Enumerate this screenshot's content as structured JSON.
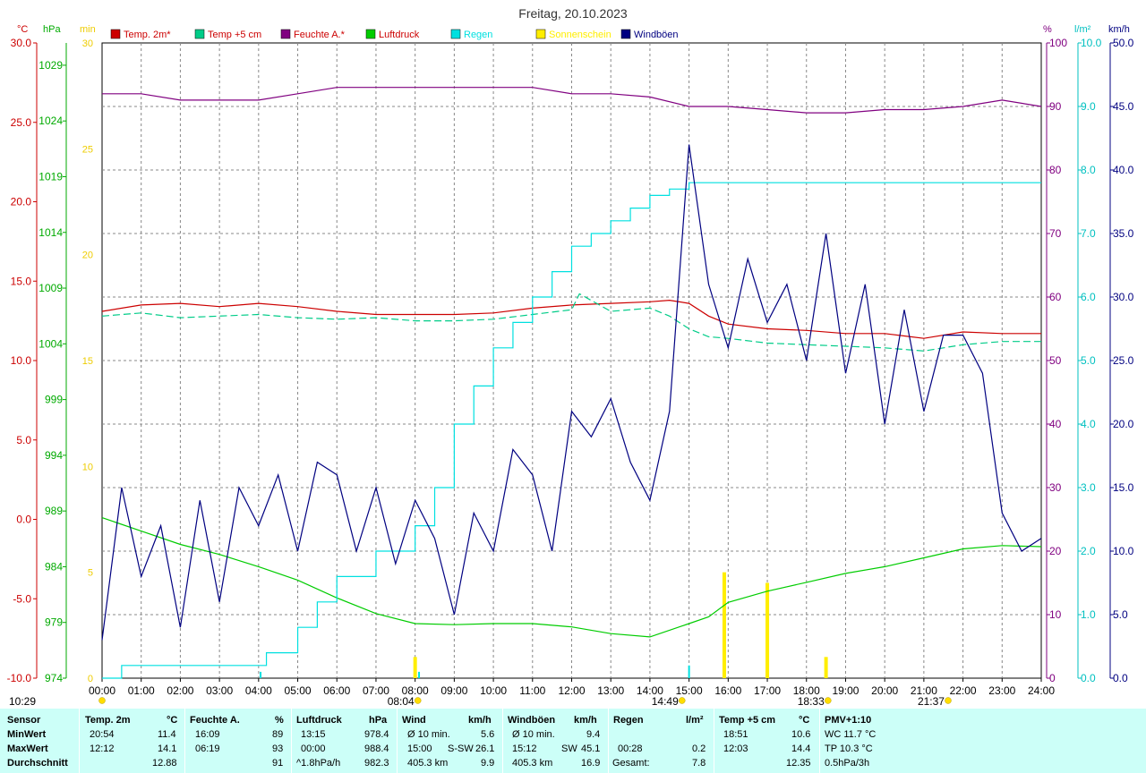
{
  "chart_data": {
    "type": "line",
    "title": "Freitag, 20.10.2023",
    "legend": [
      "Temp. 2m*",
      "Temp +5 cm",
      "Feuchte A.*",
      "Luftdruck",
      "Regen",
      "Sonnenschein",
      "Windböen"
    ],
    "colors": {
      "temp2m": "#cc0000",
      "temp5cm": "#00cc88",
      "feuchte": "#800080",
      "luftdruck": "#00cc00",
      "regen": "#00e0e0",
      "sonne": "#ffee00",
      "windboeen": "#000080",
      "grid": "#888888",
      "axis": "#000000"
    },
    "axis_units_left": [
      "°C",
      "hPa",
      "min"
    ],
    "axis_units_right": [
      "%",
      "l/m²",
      "km/h"
    ],
    "x_ticks": [
      "00:00",
      "01:00",
      "02:00",
      "03:00",
      "04:00",
      "05:00",
      "06:00",
      "07:00",
      "08:00",
      "09:00",
      "10:00",
      "11:00",
      "12:00",
      "13:00",
      "14:00",
      "15:00",
      "16:00",
      "17:00",
      "18:00",
      "19:00",
      "20:00",
      "21:00",
      "22:00",
      "23:00",
      "24:00"
    ],
    "temp_axis": {
      "range": [
        -10,
        30
      ],
      "ticks": [
        "30.0",
        "25.0",
        "20.0",
        "15.0",
        "10.0",
        "5.0",
        "0.0",
        "-5.0",
        "-10.0"
      ]
    },
    "pressure_axis": {
      "range": [
        974,
        1031
      ],
      "ticks": [
        "1029",
        "1024",
        "1019",
        "1014",
        "1009",
        "1004",
        "999",
        "994",
        "989",
        "984",
        "979",
        "974"
      ]
    },
    "sun_axis": {
      "range": [
        0,
        30
      ],
      "ticks": [
        "30",
        "25",
        "20",
        "15",
        "10",
        "5",
        "0"
      ]
    },
    "humidity_axis": {
      "range": [
        0,
        100
      ],
      "ticks": [
        "100",
        "90",
        "80",
        "70",
        "60",
        "50",
        "40",
        "30",
        "20",
        "10",
        "0"
      ]
    },
    "rain_axis": {
      "range": [
        0,
        10
      ],
      "ticks": [
        "10.0",
        "9.0",
        "8.0",
        "7.0",
        "6.0",
        "5.0",
        "4.0",
        "3.0",
        "2.0",
        "1.0",
        "0.0"
      ]
    },
    "wind_axis": {
      "range": [
        0,
        50
      ],
      "ticks": [
        "50.0",
        "45.0",
        "40.0",
        "35.0",
        "30.0",
        "25.0",
        "20.0",
        "15.0",
        "10.0",
        "5.0",
        "0.0"
      ]
    },
    "series": [
      {
        "name": "Temp. 2m*",
        "x": [
          0,
          1,
          2,
          3,
          4,
          5,
          6,
          7,
          8,
          9,
          10,
          11,
          12,
          13,
          14,
          14.5,
          15,
          15.5,
          16,
          17,
          18,
          19,
          20,
          21,
          22,
          23,
          24
        ],
        "values": [
          13.1,
          13.5,
          13.6,
          13.4,
          13.6,
          13.4,
          13.1,
          12.9,
          12.9,
          12.9,
          13.0,
          13.3,
          13.5,
          13.6,
          13.7,
          13.8,
          13.6,
          12.8,
          12.3,
          12.0,
          11.9,
          11.7,
          11.7,
          11.4,
          11.8,
          11.7,
          11.7
        ]
      },
      {
        "name": "Temp +5 cm",
        "x": [
          0,
          1,
          2,
          3,
          4,
          5,
          6,
          7,
          8,
          9,
          10,
          11,
          12,
          12.2,
          13,
          14,
          14.5,
          15,
          15.5,
          16,
          17,
          18,
          19,
          20,
          21,
          22,
          23,
          24
        ],
        "values": [
          12.8,
          13.0,
          12.7,
          12.8,
          12.9,
          12.7,
          12.6,
          12.7,
          12.5,
          12.5,
          12.6,
          12.9,
          13.2,
          14.2,
          13.1,
          13.3,
          12.8,
          12.0,
          11.5,
          11.4,
          11.1,
          11.0,
          10.9,
          10.8,
          10.6,
          11.0,
          11.2,
          11.2
        ]
      },
      {
        "name": "Feuchte A.*",
        "x": [
          0,
          1,
          2,
          3,
          4,
          5,
          6,
          7,
          8,
          9,
          10,
          11,
          12,
          13,
          14,
          15,
          15.5,
          16,
          17,
          18,
          19,
          20,
          21,
          22,
          23,
          24
        ],
        "values": [
          92,
          92,
          91,
          91,
          91,
          92,
          93,
          93,
          93,
          93,
          93,
          93,
          92,
          92,
          91.5,
          90,
          90,
          90,
          89.5,
          89,
          89,
          89.5,
          89.5,
          90,
          91,
          90
        ]
      },
      {
        "name": "Luftdruck",
        "x": [
          0,
          1,
          2,
          3,
          4,
          5,
          6,
          7,
          8,
          9,
          10,
          11,
          12,
          13,
          14,
          15,
          15.5,
          16,
          17,
          18,
          19,
          20,
          21,
          22,
          23,
          24
        ],
        "values": [
          988.4,
          987.2,
          986.0,
          985.1,
          984.0,
          982.8,
          981.2,
          979.8,
          978.9,
          978.8,
          978.9,
          978.9,
          978.6,
          978.0,
          977.7,
          978.9,
          979.5,
          980.8,
          981.8,
          982.6,
          983.4,
          984.0,
          984.8,
          985.6,
          985.9,
          985.8
        ]
      },
      {
        "name": "Regen",
        "x": [
          0,
          0.5,
          4,
          4.2,
          5,
          5.5,
          6,
          7,
          8,
          8.5,
          9,
          9.5,
          10,
          10.5,
          11,
          11.5,
          12,
          12.5,
          13,
          13.5,
          14,
          14.5,
          15,
          24
        ],
        "values": [
          0,
          0.2,
          0.2,
          0.4,
          0.8,
          1.2,
          1.6,
          2.0,
          2.4,
          3.0,
          4.0,
          4.6,
          5.2,
          5.6,
          6.0,
          6.4,
          6.8,
          7.0,
          7.2,
          7.4,
          7.6,
          7.7,
          7.8,
          7.8
        ]
      },
      {
        "name": "Windböen",
        "x": [
          0,
          0.5,
          1,
          1.5,
          2,
          2.5,
          3,
          3.5,
          4,
          4.5,
          5,
          5.5,
          6,
          6.5,
          7,
          7.5,
          8,
          8.5,
          9,
          9.5,
          10,
          10.5,
          11,
          11.5,
          12,
          12.5,
          13,
          13.5,
          14,
          14.5,
          15,
          15.5,
          16,
          16.5,
          17,
          17.5,
          18,
          18.5,
          19,
          19.5,
          20,
          20.5,
          21,
          21.5,
          22,
          22.5,
          23,
          23.5,
          24
        ],
        "values": [
          3,
          15,
          8,
          12,
          4,
          14,
          6,
          15,
          12,
          16,
          10,
          17,
          16,
          10,
          15,
          9,
          14,
          11,
          5,
          13,
          10,
          18,
          16,
          10,
          21,
          19,
          22,
          17,
          14,
          21,
          42,
          31,
          26,
          33,
          28,
          31,
          25,
          35,
          24,
          31,
          20,
          29,
          21,
          27,
          27,
          24,
          13,
          10,
          11
        ]
      }
    ],
    "rain_bars": [
      {
        "x": 4.05,
        "value": 0.1
      },
      {
        "x": 8.1,
        "value": 0.1
      },
      {
        "x": 15.0,
        "value": 0.2
      }
    ],
    "sun_bars": [
      {
        "x": 8.0,
        "value": 1
      },
      {
        "x": 15.9,
        "value": 5
      },
      {
        "x": 17.0,
        "value": 4.5
      },
      {
        "x": 18.5,
        "value": 1
      }
    ],
    "sun_markers": [
      {
        "x": 0.0,
        "label": "10:29"
      },
      {
        "x": 8.07,
        "label": "08:04"
      },
      {
        "x": 14.82,
        "label": "14:49"
      },
      {
        "x": 18.55,
        "label": "18:33"
      },
      {
        "x": 21.62,
        "label": "21:37"
      }
    ]
  },
  "table": {
    "headers": {
      "sensor": "Sensor",
      "temp": "Temp. 2m",
      "temp_unit": "°C",
      "feuchte": "Feuchte A.",
      "feuchte_unit": "%",
      "druck": "Luftdruck",
      "druck_unit": "hPa",
      "wind": "Wind",
      "wind_unit": "km/h",
      "boeen": "Windböen",
      "boeen_unit": "km/h",
      "regen": "Regen",
      "regen_unit": "l/m²",
      "temp5": "Temp +5 cm",
      "temp5_unit": "°C",
      "pmv": "PMV+1:10"
    },
    "rows": [
      {
        "label": "MinWert",
        "temp_t": "20:54",
        "temp_v": "11.4",
        "feu_t": "16:09",
        "feu_v": "89",
        "dr_t": "13:15",
        "dr_v": "978.4",
        "wind_l": "Ø 10 min.",
        "wind_m": "",
        "wind_v": "5.6",
        "boe_l": "Ø 10 min.",
        "boe_m": "",
        "boe_v": "9.4",
        "reg_t": "",
        "reg_v": "",
        "t5_t": "18:51",
        "t5_v": "10.6",
        "pmv": "WC 11.7 °C"
      },
      {
        "label": "MaxWert",
        "temp_t": "12:12",
        "temp_v": "14.1",
        "feu_t": "06:19",
        "feu_v": "93",
        "dr_t": "00:00",
        "dr_v": "988.4",
        "wind_l": "15:00",
        "wind_m": "S-SW",
        "wind_v": "26.1",
        "boe_l": "15:12",
        "boe_m": "SW",
        "boe_v": "45.1",
        "reg_t": "00:28",
        "reg_v": "0.2",
        "t5_t": "12:03",
        "t5_v": "14.4",
        "pmv": "TP 10.3 °C"
      },
      {
        "label": "Durchschnitt",
        "temp_t": "",
        "temp_v": "12.88",
        "feu_t": "",
        "feu_v": "91",
        "dr_t": "^1.8hPa/h",
        "dr_v": "982.3",
        "wind_l": "405.3 km",
        "wind_m": "",
        "wind_v": "9.9",
        "boe_l": "405.3 km",
        "boe_m": "",
        "boe_v": "16.9",
        "reg_t": "Gesamt:",
        "reg_v": "7.8",
        "t5_t": "",
        "t5_v": "12.35",
        "pmv": "0.5hPa/3h"
      }
    ]
  }
}
